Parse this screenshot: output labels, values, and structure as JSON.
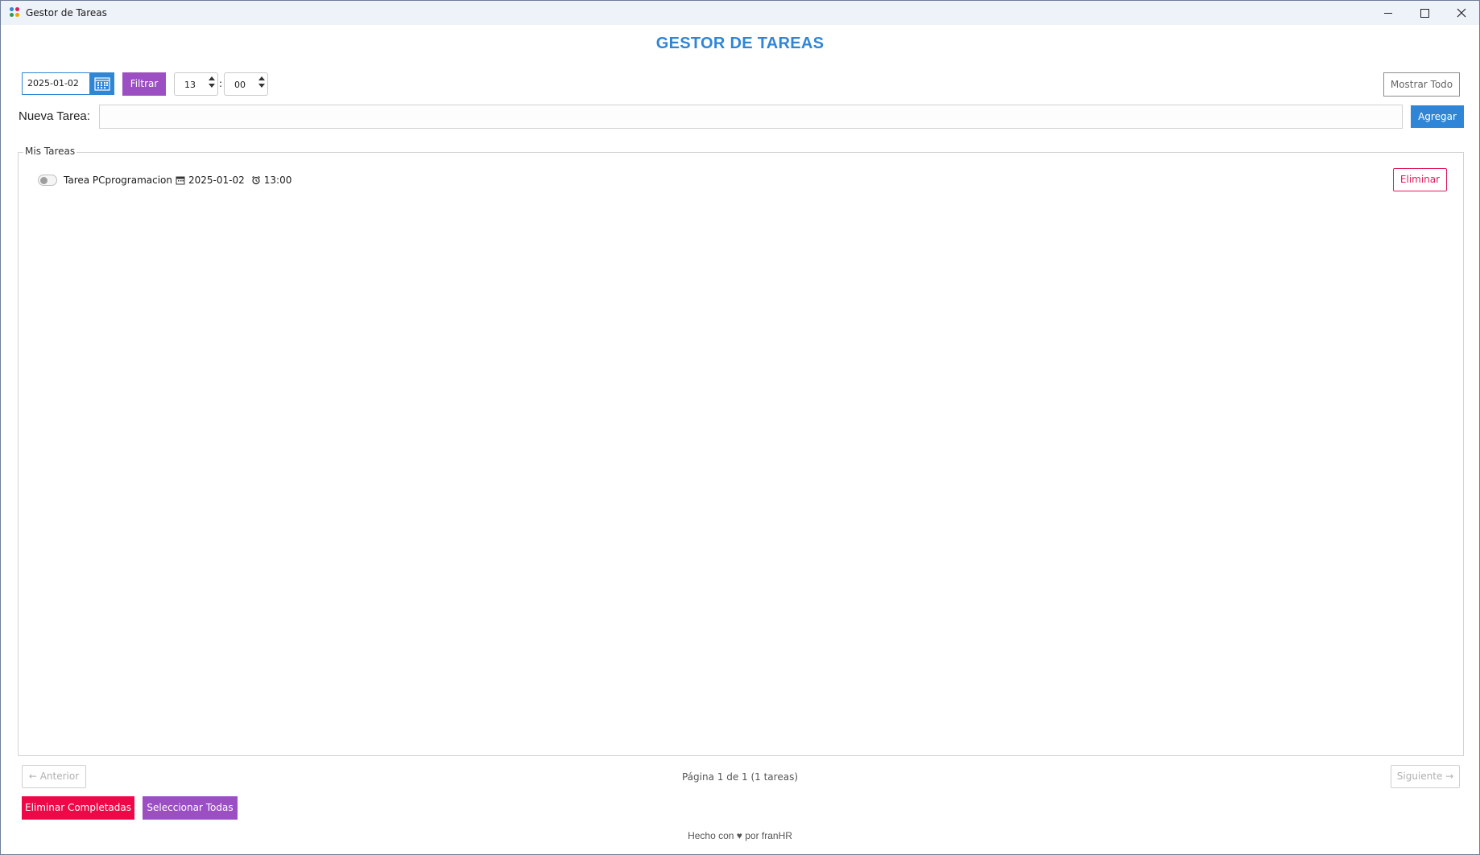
{
  "window": {
    "title": "Gestor de Tareas"
  },
  "header": {
    "title": "GESTOR DE TAREAS"
  },
  "filter": {
    "date_value": "2025-01-02",
    "filter_label": "Filtrar",
    "hour_value": "13",
    "minute_value": "00",
    "time_separator": ":",
    "show_all_label": "Mostrar Todo"
  },
  "new_task": {
    "label": "Nueva Tarea:",
    "value": "",
    "add_label": "Agregar"
  },
  "tasks": {
    "group_title": "Mis Tareas",
    "items": [
      {
        "name": "Tarea PCprogramacion",
        "date": "2025-01-02",
        "time": "13:00",
        "completed": false,
        "delete_label": "Eliminar"
      }
    ]
  },
  "pagination": {
    "prev_label": "← Anterior",
    "info": "Página 1 de 1 (1 tareas)",
    "next_label": "Siguiente →"
  },
  "actions": {
    "delete_completed_label": "Eliminar Completadas",
    "select_all_label": "Seleccionar Todas"
  },
  "footer": {
    "text": "Hecho con ♥ por franHR"
  },
  "colors": {
    "accent_blue": "#2f86d6",
    "purple": "#9b4fc2",
    "danger": "#ee0848",
    "delete_outline": "#e01c5b"
  }
}
